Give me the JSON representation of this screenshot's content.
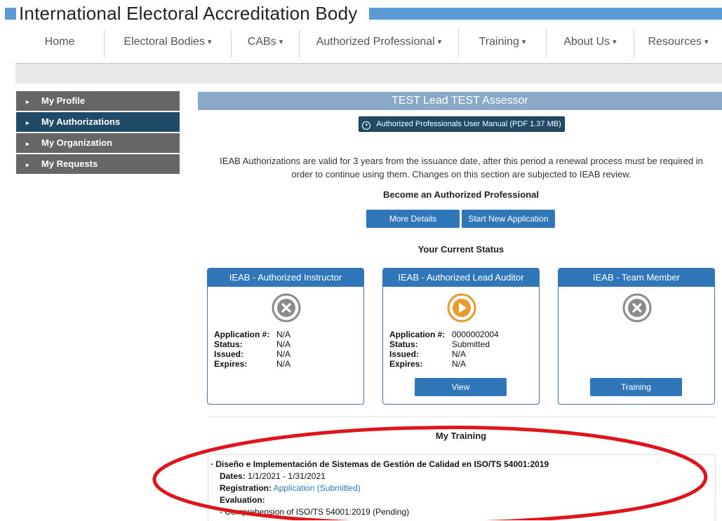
{
  "header": {
    "title": "International Electoral Accreditation Body"
  },
  "nav": {
    "items": [
      {
        "label": "Home",
        "caret": ""
      },
      {
        "label": "Electoral Bodies",
        "caret": "▾"
      },
      {
        "label": "CABs",
        "caret": "▾"
      },
      {
        "label": "Authorized Professional",
        "caret": "▾"
      },
      {
        "label": "Training",
        "caret": "▾"
      },
      {
        "label": "About Us",
        "caret": "▾"
      },
      {
        "label": "Resources",
        "caret": "▾"
      }
    ]
  },
  "sidebar": {
    "items": [
      {
        "label": "My Profile"
      },
      {
        "label": "My Authorizations"
      },
      {
        "label": "My Organization"
      },
      {
        "label": "My Requests"
      }
    ]
  },
  "main": {
    "title": "TEST Lead TEST Assessor",
    "manual_button": "Authorized Professionals User Manual (PDF 1.37 MB)",
    "notice": "IEAB Authorizations are valid for 3 years from the issuance date, after this period a renewal process must be required in order to continue using them. Changes on this section are subjected to IEAB review.",
    "become_heading": "Become an Authorized Professional",
    "more_details": "More Details",
    "start_application": "Start New Application",
    "status_heading": "Your Current Status"
  },
  "cards": [
    {
      "title": "IEAB - Authorized Instructor",
      "icon": "x-circle-icon",
      "rows": [
        {
          "k": "Application #:",
          "v": "N/A"
        },
        {
          "k": "Status:",
          "v": "N/A"
        },
        {
          "k": "Issued:",
          "v": "N/A"
        },
        {
          "k": "Expires:",
          "v": "N/A"
        }
      ]
    },
    {
      "title": "IEAB - Authorized Lead Auditor",
      "icon": "play-circle-icon",
      "rows": [
        {
          "k": "Application #:",
          "v": "0000002004"
        },
        {
          "k": "Status:",
          "v": "Submitted"
        },
        {
          "k": "Issued:",
          "v": "N/A"
        },
        {
          "k": "Expires:",
          "v": "N/A"
        }
      ],
      "button": "View"
    },
    {
      "title": "IEAB - Team Member",
      "icon": "x-circle-icon",
      "button": "Training"
    }
  ],
  "training": {
    "heading": "My Training",
    "course": "Diseño e Implementación de Sistemas de Gestión de Calidad en ISO/TS 54001:2019",
    "dates_label": "Dates:",
    "dates_value": "1/1/2021 - 1/31/2021",
    "registration_label": "Registration:",
    "registration_value": "Application (Submitted)",
    "evaluation_label": "Evaluation:",
    "evaluation_item": "- Comprehension of ISO/TS 54001:2019 (Pending)"
  },
  "colors": {
    "brand_blue": "#5b9bd5",
    "sidebar_active": "#1f4b66",
    "button_blue": "#2f77b8",
    "status_orange": "#e89a2c",
    "status_gray": "#8a8a8a",
    "highlight_red": "#e0141b"
  }
}
